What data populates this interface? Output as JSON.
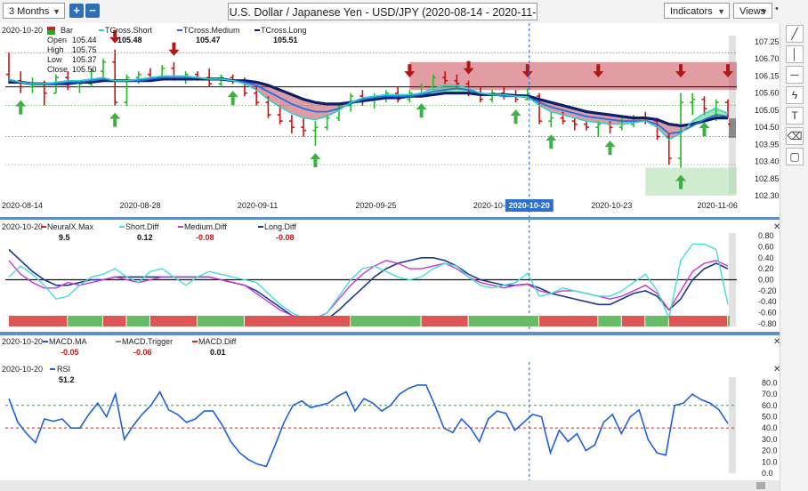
{
  "toolbar": {
    "period": "3 Months",
    "zoom_in": "+",
    "zoom_out": "−",
    "title": "U.S. Dollar / Japanese Yen - USD/JPY (2020-08-14 - 2020-11-16)",
    "indicators": "Indicators",
    "views": "Views",
    "pin": "•"
  },
  "tools": [
    {
      "name": "line-tool-icon",
      "glyph": "╱"
    },
    {
      "name": "vertical-line-tool-icon",
      "glyph": "│"
    },
    {
      "name": "horizontal-line-tool-icon",
      "glyph": "─"
    },
    {
      "name": "fib-tool-icon",
      "glyph": "ϟ"
    },
    {
      "name": "text-tool-icon",
      "glyph": "T"
    },
    {
      "name": "eraser-tool-icon",
      "glyph": "⌫"
    },
    {
      "name": "comment-tool-icon",
      "glyph": "▢"
    }
  ],
  "colors": {
    "tcross_short": "#2fd1c8",
    "tcross_medium": "#1f6fe8",
    "tcross_long": "#0a1f6b",
    "up_bar": "#22bb22",
    "down_bar": "#cc1111",
    "short_diff": "#44ddd5",
    "medium_diff": "#cc33dd",
    "long_diff": "#1a3a8a",
    "rsi": "#1f5fd8",
    "cursor": "#1f5fc8",
    "neural_up": "#66bb66",
    "neural_down": "#dd5555",
    "zone_red": "#c94d57",
    "zone_green": "#a8dca8"
  },
  "chart_data": [
    {
      "type": "candlestick",
      "cursor_date": "2020-10-20",
      "legend": [
        {
          "name": "Bar",
          "value": ""
        },
        {
          "name": "TCross.Short",
          "value": "105.48"
        },
        {
          "name": "TCross.Medium",
          "value": "105.47"
        },
        {
          "name": "TCross.Long",
          "value": "105.51"
        }
      ],
      "ohlc_labels": [
        {
          "label": "Open",
          "value": "105.44"
        },
        {
          "label": "High",
          "value": "105.75"
        },
        {
          "label": "Low",
          "value": "105.37"
        },
        {
          "label": "Close",
          "value": "105.50"
        }
      ],
      "y_ticks": [
        "107.25",
        "106.70",
        "106.15",
        "105.60",
        "105.05",
        "104.50",
        "103.95",
        "103.40",
        "102.85",
        "102.30"
      ],
      "ylim": [
        102.3,
        107.25
      ],
      "x_ticks": [
        "2020-08-14",
        "2020-08-28",
        "2020-09-11",
        "2020-09-25",
        "2020-10-09",
        "2020-10-23",
        "2020-11-06"
      ],
      "x_cursor_label": "2020-10-20",
      "candles": [
        [
          106.2,
          106.9,
          105.9,
          106.0
        ],
        [
          106.0,
          106.3,
          105.6,
          105.8
        ],
        [
          105.8,
          106.1,
          105.6,
          105.9
        ],
        [
          105.9,
          106.0,
          105.2,
          105.6
        ],
        [
          105.6,
          106.2,
          105.6,
          106.1
        ],
        [
          106.1,
          106.3,
          105.7,
          105.8
        ],
        [
          105.8,
          106.0,
          105.6,
          105.9
        ],
        [
          105.9,
          106.4,
          105.8,
          106.3
        ],
        [
          106.3,
          106.7,
          106.0,
          106.6
        ],
        [
          106.6,
          107.0,
          105.2,
          105.3
        ],
        [
          105.3,
          106.2,
          105.2,
          106.1
        ],
        [
          106.1,
          106.3,
          105.9,
          106.2
        ],
        [
          106.2,
          106.4,
          106.0,
          106.1
        ],
        [
          106.1,
          106.5,
          106.0,
          106.4
        ],
        [
          106.4,
          106.6,
          106.0,
          106.1
        ],
        [
          106.1,
          106.3,
          105.9,
          106.2
        ],
        [
          106.2,
          106.3,
          106.0,
          106.1
        ],
        [
          106.1,
          106.4,
          105.8,
          105.9
        ],
        [
          105.9,
          106.2,
          105.8,
          106.1
        ],
        [
          106.1,
          106.2,
          105.9,
          106.0
        ],
        [
          106.0,
          106.1,
          105.5,
          105.6
        ],
        [
          105.6,
          105.8,
          105.2,
          105.3
        ],
        [
          105.3,
          105.5,
          104.8,
          104.9
        ],
        [
          104.9,
          105.2,
          104.6,
          104.7
        ],
        [
          104.7,
          104.9,
          104.3,
          104.5
        ],
        [
          104.5,
          104.8,
          104.2,
          104.4
        ],
        [
          104.4,
          104.7,
          103.9,
          104.5
        ],
        [
          104.5,
          104.9,
          104.4,
          104.8
        ],
        [
          104.8,
          105.3,
          104.7,
          105.2
        ],
        [
          105.2,
          105.6,
          105.0,
          105.5
        ],
        [
          105.5,
          105.7,
          105.2,
          105.4
        ],
        [
          105.4,
          105.6,
          105.1,
          105.5
        ],
        [
          105.5,
          105.7,
          105.3,
          105.6
        ],
        [
          105.6,
          105.8,
          105.3,
          105.4
        ],
        [
          105.4,
          105.7,
          105.3,
          105.6
        ],
        [
          105.6,
          105.9,
          105.5,
          105.8
        ],
        [
          105.8,
          106.2,
          105.7,
          106.1
        ],
        [
          106.1,
          106.3,
          105.9,
          106.0
        ],
        [
          106.0,
          106.2,
          105.8,
          105.9
        ],
        [
          105.9,
          106.0,
          105.5,
          105.6
        ],
        [
          105.6,
          105.8,
          105.3,
          105.4
        ],
        [
          105.4,
          105.7,
          105.3,
          105.6
        ],
        [
          105.6,
          105.8,
          105.4,
          105.5
        ],
        [
          105.5,
          105.7,
          105.3,
          105.4
        ],
        [
          105.4,
          105.75,
          105.37,
          105.5
        ],
        [
          105.5,
          105.6,
          104.6,
          104.7
        ],
        [
          104.7,
          105.0,
          104.5,
          104.8
        ],
        [
          104.8,
          105.0,
          104.6,
          104.7
        ],
        [
          104.7,
          104.8,
          104.4,
          104.6
        ],
        [
          104.6,
          104.7,
          104.4,
          104.5
        ],
        [
          104.5,
          104.7,
          104.2,
          104.6
        ],
        [
          104.6,
          104.7,
          104.3,
          104.5
        ],
        [
          104.5,
          104.8,
          104.4,
          104.6
        ],
        [
          104.6,
          104.9,
          104.5,
          104.8
        ],
        [
          104.8,
          105.0,
          104.6,
          104.7
        ],
        [
          104.7,
          104.8,
          104.1,
          104.2
        ],
        [
          104.2,
          104.3,
          103.3,
          103.5
        ],
        [
          103.5,
          105.6,
          103.2,
          105.3
        ],
        [
          105.3,
          105.6,
          104.9,
          105.4
        ],
        [
          105.4,
          105.5,
          104.9,
          105.1
        ],
        [
          105.1,
          105.4,
          104.7,
          105.3
        ],
        [
          105.3,
          105.4,
          104.8,
          104.6
        ]
      ],
      "tcross_short": [
        106.05,
        105.95,
        105.9,
        105.9,
        105.95,
        106.0,
        106.0,
        106.05,
        106.1,
        106.0,
        106.0,
        106.05,
        106.1,
        106.15,
        106.15,
        106.15,
        106.1,
        106.05,
        106.05,
        106.0,
        105.9,
        105.7,
        105.4,
        105.15,
        104.95,
        104.8,
        104.75,
        104.85,
        105.05,
        105.3,
        105.45,
        105.5,
        105.55,
        105.55,
        105.55,
        105.6,
        105.75,
        105.85,
        105.85,
        105.75,
        105.6,
        105.55,
        105.55,
        105.5,
        105.48,
        105.2,
        105.0,
        104.9,
        104.8,
        104.7,
        104.65,
        104.6,
        104.6,
        104.65,
        104.7,
        104.5,
        104.1,
        104.3,
        104.7,
        104.95,
        105.1,
        104.95
      ],
      "tcross_medium": [
        106.0,
        105.95,
        105.9,
        105.9,
        105.9,
        105.95,
        105.95,
        106.0,
        106.05,
        106.0,
        106.0,
        106.0,
        106.05,
        106.1,
        106.1,
        106.1,
        106.1,
        106.05,
        106.05,
        106.0,
        105.95,
        105.85,
        105.65,
        105.45,
        105.25,
        105.1,
        105.0,
        105.0,
        105.1,
        105.25,
        105.4,
        105.45,
        105.5,
        105.5,
        105.5,
        105.55,
        105.65,
        105.7,
        105.75,
        105.7,
        105.6,
        105.55,
        105.5,
        105.5,
        105.47,
        105.3,
        105.15,
        105.05,
        104.95,
        104.85,
        104.8,
        104.75,
        104.7,
        104.7,
        104.7,
        104.6,
        104.3,
        104.35,
        104.55,
        104.75,
        104.9,
        104.85
      ],
      "tcross_long": [
        105.95,
        105.95,
        105.9,
        105.9,
        105.9,
        105.9,
        105.95,
        105.95,
        106.0,
        106.0,
        106.0,
        106.0,
        106.0,
        106.05,
        106.05,
        106.05,
        106.05,
        106.05,
        106.05,
        106.0,
        106.0,
        105.95,
        105.85,
        105.7,
        105.55,
        105.4,
        105.3,
        105.25,
        105.25,
        105.3,
        105.35,
        105.4,
        105.45,
        105.45,
        105.5,
        105.5,
        105.55,
        105.6,
        105.6,
        105.6,
        105.55,
        105.55,
        105.55,
        105.52,
        105.51,
        105.4,
        105.3,
        105.2,
        105.1,
        105.0,
        104.95,
        104.9,
        104.85,
        104.8,
        104.8,
        104.75,
        104.6,
        104.55,
        104.6,
        104.7,
        104.8,
        104.8
      ],
      "reference_level": 105.8,
      "resistance_zone": [
        105.7,
        106.6
      ],
      "support_zone": [
        102.3,
        103.2
      ],
      "down_arrows": [
        9,
        14,
        34,
        39,
        44,
        50,
        57,
        61
      ],
      "up_arrows": [
        1,
        9,
        19,
        26,
        35,
        43,
        46,
        51,
        57,
        59
      ]
    },
    {
      "type": "line",
      "cursor_date": "2020-10-20",
      "legend": [
        {
          "name": "NeuralX.Max",
          "value": "9.5"
        },
        {
          "name": "Short.Diff",
          "value": "0.12"
        },
        {
          "name": "Medium.Diff",
          "value": "-0.08"
        },
        {
          "name": "Long.Diff",
          "value": "-0.08"
        }
      ],
      "y_ticks": [
        "0.80",
        "0.60",
        "0.40",
        "0.20",
        "0.00",
        "-0.20",
        "-0.40",
        "-0.60",
        "-0.80"
      ],
      "ylim": [
        -0.85,
        0.85
      ],
      "short_diff": [
        0.05,
        0.25,
        0.1,
        -0.1,
        -0.35,
        -0.3,
        -0.1,
        0.05,
        0.1,
        0.2,
        0.05,
        -0.05,
        0.15,
        0.2,
        0.05,
        -0.1,
        0.05,
        0.15,
        0.1,
        0.05,
        0.0,
        -0.05,
        -0.25,
        -0.45,
        -0.6,
        -0.7,
        -0.72,
        -0.6,
        -0.3,
        0.0,
        0.2,
        0.25,
        0.15,
        0.05,
        0.0,
        0.05,
        0.2,
        0.3,
        0.25,
        0.05,
        -0.1,
        -0.15,
        -0.1,
        -0.05,
        0.12,
        -0.3,
        -0.25,
        -0.15,
        -0.2,
        -0.25,
        -0.3,
        -0.3,
        -0.2,
        -0.05,
        0.1,
        -0.2,
        -0.7,
        0.35,
        0.65,
        0.65,
        0.55,
        -0.45
      ],
      "medium_diff": [
        0.35,
        0.1,
        -0.05,
        -0.15,
        -0.15,
        -0.05,
        -0.1,
        -0.05,
        0.0,
        0.05,
        0.0,
        -0.05,
        0.0,
        0.05,
        0.05,
        0.05,
        0.05,
        0.05,
        0.0,
        -0.05,
        -0.1,
        -0.25,
        -0.4,
        -0.55,
        -0.65,
        -0.7,
        -0.7,
        -0.6,
        -0.35,
        -0.1,
        0.1,
        0.25,
        0.35,
        0.3,
        0.2,
        0.2,
        0.25,
        0.3,
        0.2,
        0.05,
        -0.05,
        -0.1,
        -0.15,
        -0.1,
        -0.08,
        -0.2,
        -0.25,
        -0.2,
        -0.2,
        -0.25,
        -0.3,
        -0.35,
        -0.3,
        -0.2,
        -0.1,
        -0.25,
        -0.55,
        -0.2,
        0.15,
        0.3,
        0.35,
        0.25
      ],
      "long_diff": [
        0.55,
        0.35,
        0.15,
        0.0,
        -0.1,
        -0.1,
        -0.05,
        0.0,
        0.0,
        0.05,
        0.05,
        0.05,
        0.05,
        0.05,
        0.05,
        0.05,
        0.05,
        0.05,
        0.0,
        -0.05,
        -0.1,
        -0.2,
        -0.35,
        -0.5,
        -0.65,
        -0.75,
        -0.78,
        -0.72,
        -0.55,
        -0.35,
        -0.15,
        0.05,
        0.2,
        0.3,
        0.35,
        0.4,
        0.4,
        0.35,
        0.25,
        0.1,
        0.0,
        -0.05,
        -0.1,
        -0.1,
        -0.08,
        -0.15,
        -0.25,
        -0.3,
        -0.35,
        -0.4,
        -0.45,
        -0.45,
        -0.35,
        -0.25,
        -0.2,
        -0.3,
        -0.55,
        -0.35,
        0.0,
        0.2,
        0.3,
        0.2
      ],
      "neural_segments": [
        {
          "dir": "down",
          "from": 0,
          "to": 5
        },
        {
          "dir": "up",
          "from": 5,
          "to": 8
        },
        {
          "dir": "down",
          "from": 8,
          "to": 10
        },
        {
          "dir": "up",
          "from": 10,
          "to": 12
        },
        {
          "dir": "down",
          "from": 12,
          "to": 16
        },
        {
          "dir": "up",
          "from": 16,
          "to": 20
        },
        {
          "dir": "down",
          "from": 20,
          "to": 29
        },
        {
          "dir": "up",
          "from": 29,
          "to": 35
        },
        {
          "dir": "down",
          "from": 35,
          "to": 39
        },
        {
          "dir": "up",
          "from": 39,
          "to": 45
        },
        {
          "dir": "down",
          "from": 45,
          "to": 50
        },
        {
          "dir": "up",
          "from": 50,
          "to": 52
        },
        {
          "dir": "down",
          "from": 52,
          "to": 54
        },
        {
          "dir": "up",
          "from": 54,
          "to": 56
        },
        {
          "dir": "down",
          "from": 56,
          "to": 61
        },
        {
          "dir": "up",
          "from": 61,
          "to": 62
        }
      ]
    },
    {
      "type": "line",
      "cursor_date": "2020-10-20",
      "legend": [
        {
          "name": "MACD.MA",
          "value": "-0.05"
        },
        {
          "name": "MACD.Trigger",
          "value": "-0.06"
        },
        {
          "name": "MACD.Diff",
          "value": "0.01"
        }
      ]
    },
    {
      "type": "line",
      "cursor_date": "2020-10-20",
      "legend": [
        {
          "name": "RSI",
          "value": "51.2"
        }
      ],
      "y_ticks": [
        "80.0",
        "70.0",
        "60.0",
        "50.0",
        "40.0",
        "30.0",
        "20.0",
        "10.0",
        "0.0"
      ],
      "ylim": [
        0,
        85
      ],
      "overbought": 60,
      "oversold": 40,
      "rsi": [
        66,
        45,
        35,
        27,
        48,
        46,
        48,
        40,
        40,
        52,
        62,
        50,
        70,
        30,
        42,
        52,
        60,
        72,
        56,
        52,
        45,
        48,
        55,
        55,
        43,
        28,
        18,
        12,
        8,
        6,
        25,
        45,
        60,
        64,
        58,
        60,
        62,
        68,
        72,
        55,
        66,
        62,
        55,
        60,
        70,
        75,
        78,
        78,
        60,
        40,
        36,
        48,
        40,
        28,
        48,
        55,
        53,
        38,
        45,
        52,
        50,
        18,
        38,
        28,
        35,
        20,
        25,
        45,
        52,
        35,
        50,
        56,
        30,
        18,
        16,
        60,
        62,
        70,
        65,
        62,
        56,
        44
      ]
    }
  ]
}
